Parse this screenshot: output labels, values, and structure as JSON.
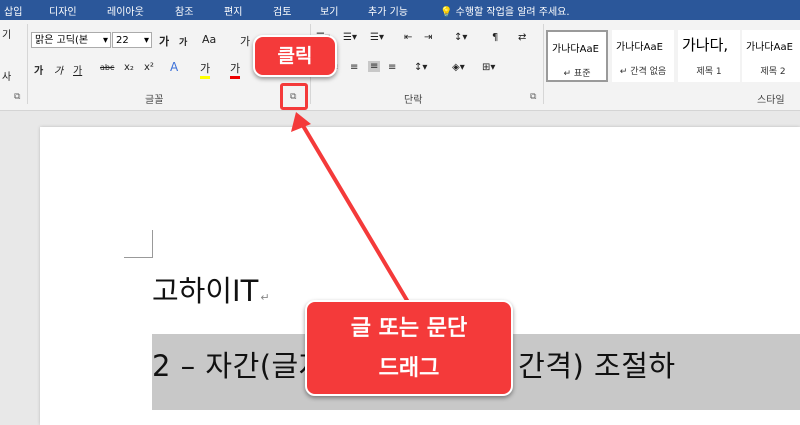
{
  "tabs": [
    "삽입",
    "디자인",
    "레이아웃",
    "참조",
    "편지",
    "검토",
    "보기",
    "추가 기능"
  ],
  "tell_me": "수행할 작업을 알려 주세요.",
  "font": {
    "left_partial_top": "기",
    "left_partial_bottom": "사",
    "name": "맑은 고딕(본",
    "size": "22",
    "grow": "가",
    "shrink": "가",
    "case": "Aa",
    "clear": "가",
    "bold": "가",
    "italic": "가",
    "underline": "가",
    "strike": "abc",
    "subscript": "x₂",
    "superscript": "x²",
    "highlight_letter": "가",
    "color_letter": "가",
    "group_label": "글꼴"
  },
  "paragraph": {
    "group_label": "단락"
  },
  "styles": {
    "group_label": "스타일",
    "items": [
      {
        "sample": "가나다AaE",
        "name": "↵ 표준"
      },
      {
        "sample": "가나다AaE",
        "name": "↵ 간격 없음"
      },
      {
        "sample": "가나다,",
        "name": "제목 1"
      },
      {
        "sample": "가나다AaE",
        "name": "제목 2"
      }
    ]
  },
  "document": {
    "heading": "고하이IT",
    "para_mark": "↵",
    "body_line": "2 –  자간(글자와 글자  사이의  간격)  조절하"
  },
  "annotations": {
    "click_label": "클릭",
    "drag_line1": "글 또는 문단",
    "drag_line2": "드래그"
  },
  "colors": {
    "accent": "#2b579a",
    "callout": "#f43a3a"
  }
}
